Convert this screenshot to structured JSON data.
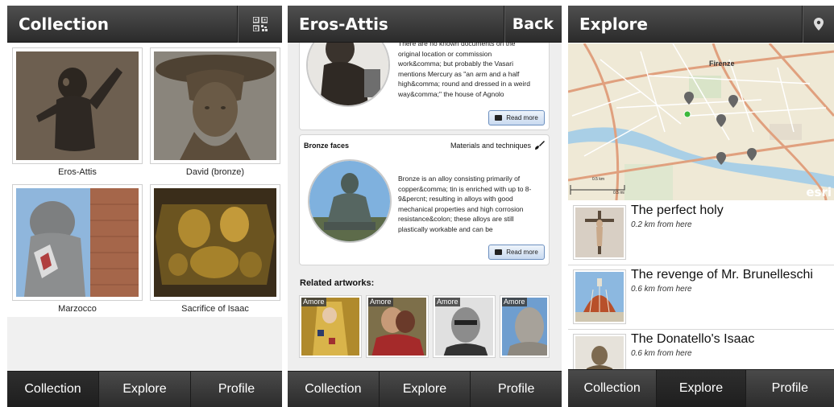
{
  "collection": {
    "title": "Collection",
    "header_icon": "qr-code-icon",
    "items": [
      {
        "label": "Eros-Attis"
      },
      {
        "label": "David (bronze)"
      },
      {
        "label": "Marzocco"
      },
      {
        "label": "Sacrifice of Isaac"
      }
    ]
  },
  "detail": {
    "title": "Eros-Attis",
    "back_label": "Back",
    "card1": {
      "text_lines": [
        "There are no known documents on the",
        "original location or commission",
        "work&comma; but probably the Vasari",
        "mentions Mercury as \"an arm and a half",
        "high&comma; round and dressed in a weird",
        "way&comma;\" the house of Agnolo"
      ],
      "read_more": "Read more"
    },
    "card2": {
      "heading": "Bronze faces",
      "category": "Materials and techniques",
      "category_icon": "brush-icon",
      "text_lines": [
        "Bronze is an alloy consisting primarily of",
        "copper&comma; tin is enriched with up to 8-",
        "9&percnt; resulting in alloys with good",
        "mechanical properties and high corrosion",
        "resistance&colon; these alloys are still",
        "plastically workable and can be"
      ],
      "read_more": "Read more"
    },
    "related_title": "Related artworks:",
    "related": [
      {
        "tag": "Amore"
      },
      {
        "tag": "Amore"
      },
      {
        "tag": "Amore"
      },
      {
        "tag": "Amore"
      }
    ]
  },
  "explore": {
    "title": "Explore",
    "header_icon": "location-pin-icon",
    "map": {
      "city_label": "Firenze",
      "scale_km": "0.5 km",
      "scale_mi": "0.5 mi",
      "attribution": "esri"
    },
    "places": [
      {
        "title": "The perfect holy",
        "distance": "0.2 km from here"
      },
      {
        "title": "The revenge of Mr. Brunelleschi",
        "distance": "0.6 km from here"
      },
      {
        "title": "The Donatello's Isaac",
        "distance": "0.6 km from here"
      }
    ]
  },
  "tabs": {
    "collection": "Collection",
    "explore": "Explore",
    "profile": "Profile"
  }
}
